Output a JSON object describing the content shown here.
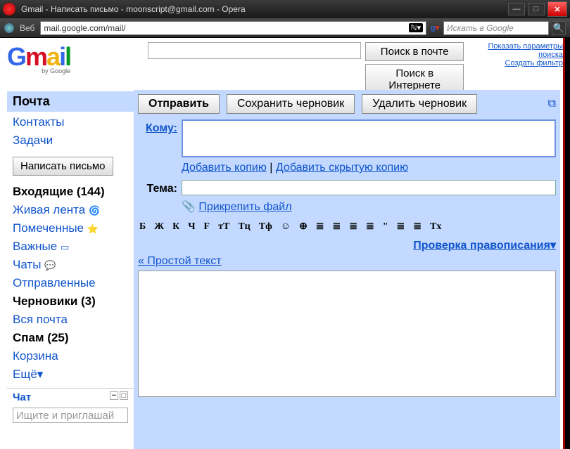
{
  "window": {
    "title": "Gmail - Написать письмо - moonscript@gmail.com - Opera"
  },
  "addressbar": {
    "veb_label": "Веб",
    "url": "mail.google.com/mail/",
    "search_placeholder": "Искать в Google"
  },
  "top": {
    "search_mail": "Поиск в почте",
    "search_web": "Поиск в Интернете",
    "links": {
      "show_opts": "Показать параметры поиска",
      "create_filter": "Создать фильтр"
    }
  },
  "sidebar": {
    "tab_mail": "Почта",
    "nav": {
      "contacts": "Контакты",
      "tasks": "Задачи"
    },
    "compose": "Написать письмо",
    "folders": [
      {
        "label": "Входящие (144)",
        "bold": true
      },
      {
        "label": "Живая лента",
        "icon": "🌀"
      },
      {
        "label": "Помеченные",
        "icon": "⭐"
      },
      {
        "label": "Важные",
        "icon": "▭"
      },
      {
        "label": "Чаты",
        "icon": "💬"
      },
      {
        "label": "Отправленные"
      },
      {
        "label": "Черновики (3)",
        "bold": true
      },
      {
        "label": "Вся почта"
      },
      {
        "label": "Спам (25)",
        "bold": true
      },
      {
        "label": "Корзина"
      },
      {
        "label": "Ещё▾"
      }
    ],
    "chat_header": "Чат",
    "chat_search_placeholder": "Ищите и приглашай"
  },
  "compose": {
    "send": "Отправить",
    "save_draft": "Сохранить черновик",
    "discard": "Удалить черновик",
    "to_label": "Кому:",
    "add_cc": "Добавить копию",
    "add_bcc": "Добавить скрытую копию",
    "subject_label": "Тема:",
    "attach": "Прикрепить файл",
    "spellcheck": "Проверка правописания",
    "plain_text": "« Простой текст"
  },
  "toolbar": {
    "items": [
      "Б",
      "Ж",
      "К",
      "Ч",
      "F",
      "тТ",
      "Tц",
      "Tф",
      "☺",
      "⊕",
      "≣",
      "≣",
      "≣",
      "≣",
      "\"",
      "≣",
      "≣",
      "Tx"
    ]
  }
}
